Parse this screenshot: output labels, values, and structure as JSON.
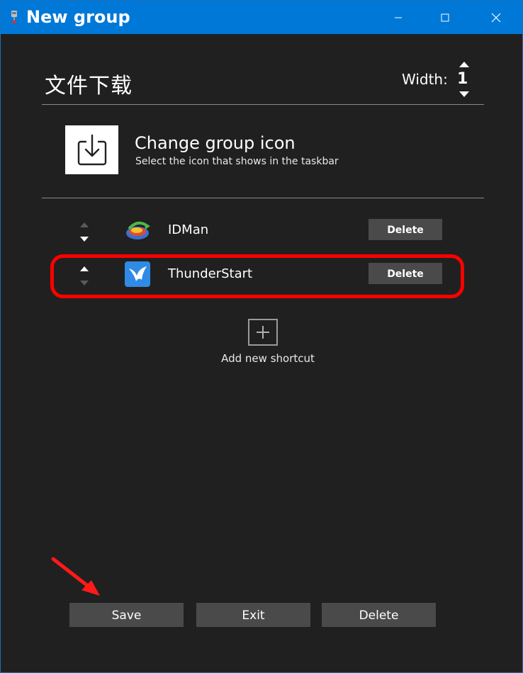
{
  "window": {
    "title": "New group",
    "accent_color": "#0078d7"
  },
  "group": {
    "name": "文件下载",
    "width_label": "Width:",
    "width_value": "1"
  },
  "group_icon": {
    "title": "Change group icon",
    "subtitle": "Select the icon that shows in the taskbar",
    "icon": "download-icon"
  },
  "shortcuts": [
    {
      "name": "IDMan",
      "icon": "idm-app-icon",
      "delete_label": "Delete"
    },
    {
      "name": "ThunderStart",
      "icon": "thunder-app-icon",
      "delete_label": "Delete"
    }
  ],
  "add_shortcut": {
    "label": "Add new shortcut",
    "icon": "plus-icon"
  },
  "footer": {
    "save_label": "Save",
    "exit_label": "Exit",
    "delete_label": "Delete"
  },
  "annotations": {
    "highlight_color": "#ff0000"
  }
}
